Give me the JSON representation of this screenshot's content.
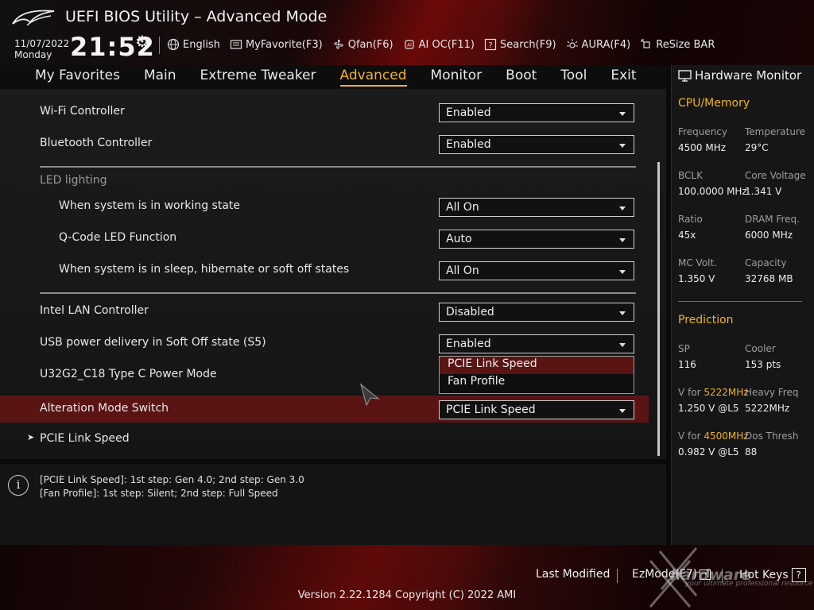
{
  "header": {
    "title": "UEFI BIOS Utility – Advanced Mode",
    "date": "11/07/2022",
    "day": "Monday",
    "time": "21:52",
    "toolbar": [
      {
        "label": "English",
        "icon": "globe-icon"
      },
      {
        "label": "MyFavorite(F3)",
        "icon": "favorite-icon"
      },
      {
        "label": "Qfan(F6)",
        "icon": "fan-icon"
      },
      {
        "label": "AI OC(F11)",
        "icon": "ai-chip-icon"
      },
      {
        "label": "Search(F9)",
        "icon": "search-icon"
      },
      {
        "label": "AURA(F4)",
        "icon": "aura-icon"
      },
      {
        "label": "ReSize BAR",
        "icon": "resize-bar-icon"
      }
    ]
  },
  "menu": {
    "tabs": [
      "My Favorites",
      "Main",
      "Extreme Tweaker",
      "Advanced",
      "Monitor",
      "Boot",
      "Tool",
      "Exit"
    ],
    "active": "Advanced"
  },
  "settings": {
    "wifi": {
      "label": "Wi-Fi Controller",
      "value": "Enabled"
    },
    "bluetooth": {
      "label": "Bluetooth Controller",
      "value": "Enabled"
    },
    "led_section": "LED lighting",
    "led_working": {
      "label": "When system is in working state",
      "value": "All On"
    },
    "qcode": {
      "label": "Q-Code LED Function",
      "value": "Auto"
    },
    "led_sleep": {
      "label": "When system is in sleep, hibernate or soft off states",
      "value": "All On"
    },
    "lan": {
      "label": "Intel LAN Controller",
      "value": "Disabled"
    },
    "usb_power": {
      "label": "USB power delivery in Soft Off state (S5)",
      "value": "Enabled"
    },
    "type_c": {
      "label": "U32G2_C18 Type C Power Mode"
    },
    "alteration": {
      "label": "Alteration Mode Switch",
      "value": "PCIE Link Speed"
    },
    "pcie_submenu": {
      "label": "PCIE Link Speed"
    }
  },
  "dropdown": {
    "options": [
      "PCIE Link Speed",
      "Fan Profile"
    ],
    "selected": "PCIE Link Speed"
  },
  "help": {
    "line1": "[PCIE Link Speed]: 1st step: Gen 4.0; 2nd step: Gen 3.0",
    "line2": "[Fan Profile]: 1st step: Silent; 2nd step: Full Speed"
  },
  "hardware_monitor": {
    "title": "Hardware Monitor",
    "cpu_section": "CPU/Memory",
    "frequency": {
      "label": "Frequency",
      "value": "4500 MHz"
    },
    "temperature": {
      "label": "Temperature",
      "value": "29°C"
    },
    "bclk": {
      "label": "BCLK",
      "value": "100.0000 MHz"
    },
    "core_voltage": {
      "label": "Core Voltage",
      "value": "1.341 V"
    },
    "ratio": {
      "label": "Ratio",
      "value": "45x"
    },
    "dram_freq": {
      "label": "DRAM Freq.",
      "value": "6000 MHz"
    },
    "mc_volt": {
      "label": "MC Volt.",
      "value": "1.350 V"
    },
    "capacity": {
      "label": "Capacity",
      "value": "32768 MB"
    },
    "prediction_section": "Prediction",
    "sp": {
      "label": "SP",
      "value": "116"
    },
    "cooler": {
      "label": "Cooler",
      "value": "153 pts"
    },
    "v_for_1": {
      "label_prefix": "V for ",
      "freq": "5222MHz",
      "value": "1.250 V @L5"
    },
    "heavy_freq": {
      "label": "Heavy Freq",
      "value": "5222MHz"
    },
    "v_for_2": {
      "label_prefix": "V for ",
      "freq": "4500MHz",
      "value": "0.982 V @L5"
    },
    "dos_thresh": {
      "label": "Dos Thresh",
      "value": "88"
    }
  },
  "footer": {
    "last_modified": "Last Modified",
    "ezmode": "EzMode(F7)",
    "ezmode_icon": "→|",
    "hot_keys": "Hot Keys",
    "hot_keys_icon": "?",
    "version": "Version 2.22.1284 Copyright (C) 2022 AMI"
  },
  "watermark": {
    "brand": "hardware",
    "tagline": "your ultimate professional resource"
  },
  "colors": {
    "accent": "#f0b323",
    "highlight_row": "#5a1414",
    "brand_red": "#9c0f0f"
  }
}
